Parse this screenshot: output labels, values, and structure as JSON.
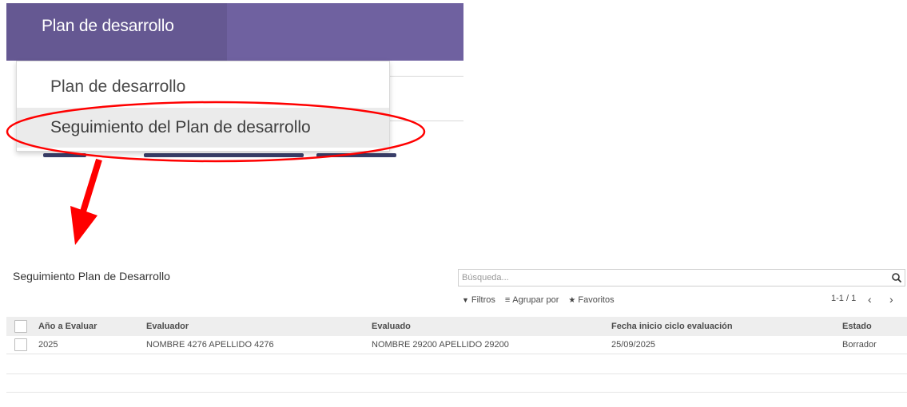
{
  "menu_shot": {
    "nav_tab_label": "Plan de desarrollo",
    "dropdown_items": [
      {
        "label": "Plan de desarrollo"
      },
      {
        "label": "Seguimiento del Plan de desarrollo"
      }
    ],
    "nav_color": "#6f61a0"
  },
  "annotation": {
    "color": "#ff0000"
  },
  "list_view": {
    "title": "Seguimiento Plan de Desarrollo",
    "search": {
      "placeholder": "Búsqueda...",
      "value": ""
    },
    "search_icon": "search-icon",
    "filters": [
      {
        "icon": "filter-icon",
        "label": "Filtros"
      },
      {
        "icon": "group-by-icon",
        "label": "Agrupar por"
      },
      {
        "icon": "star-icon",
        "label": "Favoritos"
      }
    ],
    "pager": {
      "range": "1-1 / 1",
      "prev_icon": "chevron-left-icon",
      "next_icon": "chevron-right-icon"
    },
    "columns": [
      "Año a Evaluar",
      "Evaluador",
      "Evaluado",
      "Fecha inicio ciclo evaluación",
      "Estado"
    ],
    "rows": [
      {
        "year": "2025",
        "evaluator": "NOMBRE 4276 APELLIDO 4276",
        "evaluated": "NOMBRE 29200 APELLIDO 29200",
        "start_date": "25/09/2025",
        "state": "Borrador"
      }
    ]
  }
}
